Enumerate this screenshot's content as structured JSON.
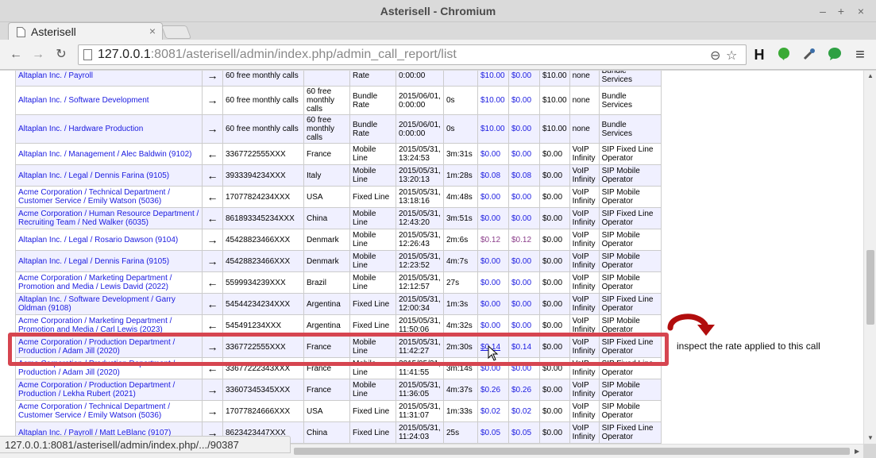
{
  "window": {
    "title": "Asterisell - Chromium",
    "minimize": "–",
    "maximize": "+",
    "close": "×"
  },
  "tab": {
    "title": "Asterisell",
    "close": "×"
  },
  "toolbar": {
    "back": "←",
    "forward": "→",
    "reload": "↻",
    "url_host": "127.0.0.1",
    "url_rest": ":8081/asterisell/admin/index.php/admin_call_report/list",
    "zoom_icon": "⊖",
    "star_icon": "☆",
    "ext_h": "H",
    "menu_icon": "≡"
  },
  "rows": [
    {
      "org": "Altaplan Inc. / Payroll",
      "dir": "→",
      "number": "60 free monthly calls",
      "location": "",
      "type": "Rate",
      "date": "0:00:00",
      "duration": "",
      "cost": "$10.00",
      "cost_purple": false,
      "income": "$0.00",
      "income_purple": false,
      "earn": "$10.00",
      "provider": "none",
      "vendor": "Bundle Services"
    },
    {
      "org": "Altaplan Inc. / Software Development",
      "dir": "→",
      "number": "60 free monthly calls",
      "location": "60 free monthly calls",
      "type": "Bundle Rate",
      "date": "2015/06/01, 0:00:00",
      "duration": "0s",
      "cost": "$10.00",
      "cost_purple": false,
      "income": "$0.00",
      "income_purple": false,
      "earn": "$10.00",
      "provider": "none",
      "vendor": "Bundle Services"
    },
    {
      "org": "Altaplan Inc. / Hardware Production",
      "dir": "→",
      "number": "60 free monthly calls",
      "location": "60 free monthly calls",
      "type": "Bundle Rate",
      "date": "2015/06/01, 0:00:00",
      "duration": "0s",
      "cost": "$10.00",
      "cost_purple": false,
      "income": "$0.00",
      "income_purple": false,
      "earn": "$10.00",
      "provider": "none",
      "vendor": "Bundle Services"
    },
    {
      "org": "Altaplan Inc. / Management / Alec Baldwin (9102)",
      "dir": "←",
      "number": "3367722555XXX",
      "location": "France",
      "type": "Mobile Line",
      "date": "2015/05/31, 13:24:53",
      "duration": "3m:31s",
      "cost": "$0.00",
      "cost_purple": false,
      "income": "$0.00",
      "income_purple": false,
      "earn": "$0.00",
      "provider": "VoIP Infinity",
      "vendor": "SIP Fixed Line Operator"
    },
    {
      "org": "Altaplan Inc. / Legal / Dennis Farina (9105)",
      "dir": "←",
      "number": "3933394234XXX",
      "location": "Italy",
      "type": "Mobile Line",
      "date": "2015/05/31, 13:20:13",
      "duration": "1m:28s",
      "cost": "$0.08",
      "cost_purple": false,
      "income": "$0.08",
      "income_purple": false,
      "earn": "$0.00",
      "provider": "VoIP Infinity",
      "vendor": "SIP Mobile Operator"
    },
    {
      "org": "Acme Corporation / Technical Department / Customer Service / Emily Watson (5036)",
      "dir": "←",
      "number": "17077824234XXX",
      "location": "USA",
      "type": "Fixed Line",
      "date": "2015/05/31, 13:18:16",
      "duration": "4m:48s",
      "cost": "$0.00",
      "cost_purple": false,
      "income": "$0.00",
      "income_purple": false,
      "earn": "$0.00",
      "provider": "VoIP Infinity",
      "vendor": "SIP Mobile Operator"
    },
    {
      "org": "Acme Corporation / Human Resource Department / Recruiting Team / Ned Walker (6035)",
      "dir": "←",
      "number": "861893345234XXX",
      "location": "China",
      "type": "Mobile Line",
      "date": "2015/05/31, 12:43:20",
      "duration": "3m:51s",
      "cost": "$0.00",
      "cost_purple": false,
      "income": "$0.00",
      "income_purple": false,
      "earn": "$0.00",
      "provider": "VoIP Infinity",
      "vendor": "SIP Fixed Line Operator"
    },
    {
      "org": "Altaplan Inc. / Legal / Rosario Dawson (9104)",
      "dir": "→",
      "number": "45428823466XXX",
      "location": "Denmark",
      "type": "Mobile Line",
      "date": "2015/05/31, 12:26:43",
      "duration": "2m:6s",
      "cost": "$0.12",
      "cost_purple": true,
      "income": "$0.12",
      "income_purple": true,
      "earn": "$0.00",
      "provider": "VoIP Infinity",
      "vendor": "SIP Mobile Operator"
    },
    {
      "org": "Altaplan Inc. / Legal / Dennis Farina (9105)",
      "dir": "→",
      "number": "45428823466XXX",
      "location": "Denmark",
      "type": "Mobile Line",
      "date": "2015/05/31, 12:23:52",
      "duration": "4m:7s",
      "cost": "$0.00",
      "cost_purple": false,
      "income": "$0.00",
      "income_purple": false,
      "earn": "$0.00",
      "provider": "VoIP Infinity",
      "vendor": "SIP Mobile Operator"
    },
    {
      "org": "Acme Corporation / Marketing Department / Promotion and Media / Lewis David (2022)",
      "dir": "←",
      "number": "5599934239XXX",
      "location": "Brazil",
      "type": "Mobile Line",
      "date": "2015/05/31, 12:12:57",
      "duration": "27s",
      "cost": "$0.00",
      "cost_purple": false,
      "income": "$0.00",
      "income_purple": false,
      "earn": "$0.00",
      "provider": "VoIP Infinity",
      "vendor": "SIP Mobile Operator"
    },
    {
      "org": "Altaplan Inc. / Software Development / Garry Oldman (9108)",
      "dir": "←",
      "number": "54544234234XXX",
      "location": "Argentina",
      "type": "Fixed Line",
      "date": "2015/05/31, 12:00:34",
      "duration": "1m:3s",
      "cost": "$0.00",
      "cost_purple": false,
      "income": "$0.00",
      "income_purple": false,
      "earn": "$0.00",
      "provider": "VoIP Infinity",
      "vendor": "SIP Fixed Line Operator"
    },
    {
      "org": "Acme Corporation / Marketing Department / Promotion and Media / Carl Lewis (2023)",
      "dir": "←",
      "number": "545491234XXX",
      "location": "Argentina",
      "type": "Fixed Line",
      "date": "2015/05/31, 11:50:06",
      "duration": "4m:32s",
      "cost": "$0.00",
      "cost_purple": false,
      "income": "$0.00",
      "income_purple": false,
      "earn": "$0.00",
      "provider": "VoIP Infinity",
      "vendor": "SIP Mobile Operator"
    },
    {
      "org": "Acme Corporation / Production Department / Production / Adam Jill (2020)",
      "dir": "→",
      "number": "3367722555XXX",
      "location": "France",
      "type": "Mobile Line",
      "date": "2015/05/31, 11:42:27",
      "duration": "2m:30s",
      "cost": "$0.14",
      "cost_purple": false,
      "cost_link": true,
      "income": "$0.14",
      "income_purple": false,
      "earn": "$0.00",
      "provider": "VoIP Infinity",
      "vendor": "SIP Fixed Line Operator"
    },
    {
      "org": "Acme Corporation / Production Department / Production / Adam Jill (2020)",
      "dir": "←",
      "number": "33677222343XXX",
      "location": "France",
      "type": "Mobile Line",
      "date": "2015/05/31, 11:41:55",
      "duration": "3m:14s",
      "cost": "$0.00",
      "cost_purple": false,
      "income": "$0.00",
      "income_purple": false,
      "earn": "$0.00",
      "provider": "VoIP Infinity",
      "vendor": "SIP Fixed Line Operator"
    },
    {
      "org": "Acme Corporation / Production Department / Production / Lekha Rubert (2021)",
      "dir": "→",
      "number": "33607345345XXX",
      "location": "France",
      "type": "Mobile Line",
      "date": "2015/05/31, 11:36:05",
      "duration": "4m:37s",
      "cost": "$0.26",
      "cost_purple": false,
      "income": "$0.26",
      "income_purple": false,
      "earn": "$0.00",
      "provider": "VoIP Infinity",
      "vendor": "SIP Mobile Operator"
    },
    {
      "org": "Acme Corporation / Technical Department / Customer Service / Emily Watson (5036)",
      "dir": "→",
      "number": "17077824666XXX",
      "location": "USA",
      "type": "Fixed Line",
      "date": "2015/05/31, 11:31:07",
      "duration": "1m:33s",
      "cost": "$0.02",
      "cost_purple": false,
      "income": "$0.02",
      "income_purple": false,
      "earn": "$0.00",
      "provider": "VoIP Infinity",
      "vendor": "SIP Mobile Operator"
    },
    {
      "org": "Altaplan Inc. / Payroll / Matt LeBlanc (9107)",
      "dir": "→",
      "number": "8623423447XXX",
      "location": "China",
      "type": "Fixed Line",
      "date": "2015/05/31, 11:24:03",
      "duration": "25s",
      "cost": "$0.05",
      "cost_purple": false,
      "income": "$0.05",
      "income_purple": false,
      "earn": "$0.00",
      "provider": "VoIP Infinity",
      "vendor": "SIP Fixed Line Operator"
    }
  ],
  "annotation": {
    "text": "inspect the rate applied to this call"
  },
  "status": {
    "text": "127.0.0.1:8081/asterisell/admin/index.php/.../90387"
  },
  "colors": {
    "highlight": "#d64550",
    "link": "#1a1ae0",
    "row_alt": "#f0f0ff"
  }
}
